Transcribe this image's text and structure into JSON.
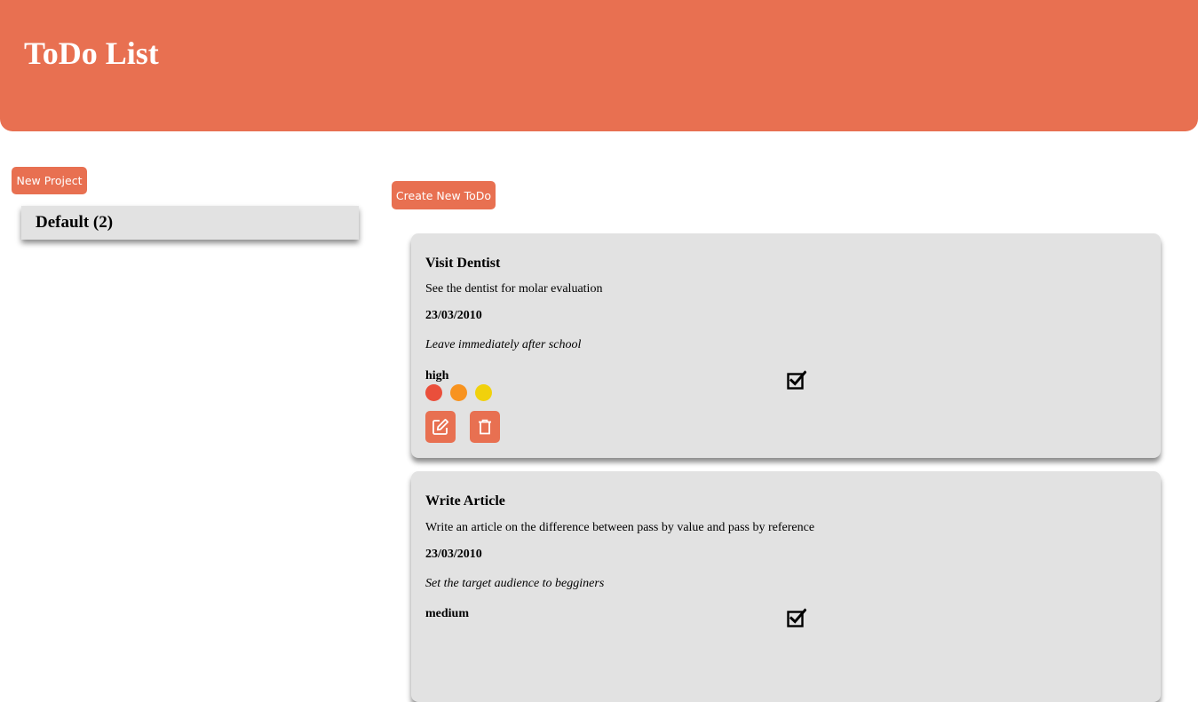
{
  "header": {
    "title": "ToDo List"
  },
  "sidebar": {
    "new_project_label": "New Project",
    "projects": [
      {
        "label": "Default (2)"
      }
    ]
  },
  "main": {
    "create_todo_label": "Create New ToDo",
    "todos": [
      {
        "title": "Visit Dentist",
        "description": "See the dentist for molar evaluation",
        "date": "23/03/2010",
        "note": "Leave immediately after school",
        "priority": "high",
        "completed": true
      },
      {
        "title": "Write Article",
        "description": "Write an article on the difference between pass by value and pass by reference",
        "date": "23/03/2010",
        "note": "Set the target audience to begginers",
        "priority": "medium",
        "completed": true
      }
    ]
  },
  "priority_colors": {
    "high": "#ea4f3b",
    "medium": "#f8931f",
    "low": "#f1d10c"
  },
  "colors": {
    "accent": "#e87051",
    "card": "#e2e2e2"
  },
  "icons": {
    "complete": "checkbox-checked-icon",
    "edit": "edit-icon",
    "delete": "trash-icon"
  }
}
